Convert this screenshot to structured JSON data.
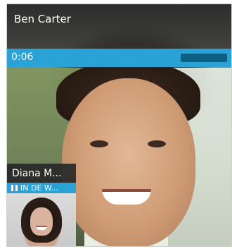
{
  "call": {
    "caller_name": "Ben Carter",
    "elapsed_time": "0:06"
  },
  "pip": {
    "name": "Diana M...",
    "status_text": "IN DE W..."
  },
  "icons": {
    "pip_status_icon": "pause-icon"
  },
  "colors": {
    "accent": "#2AA2D6",
    "progress_track": "#0F5F83",
    "overlay_dark": "#2E2E2E"
  }
}
